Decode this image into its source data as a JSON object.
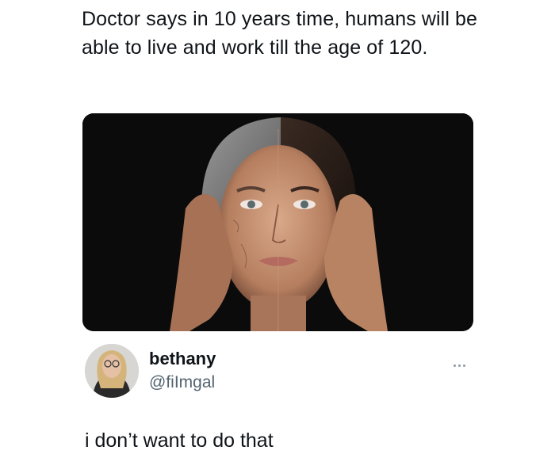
{
  "post": {
    "text": "Doctor says in 10 years time, humans will be able to live and work till the age of 120.",
    "image_description_icon": "aging-face-photo"
  },
  "reply": {
    "display_name": "bethany",
    "handle": "@fiImgal",
    "text": "i don’t want to do that",
    "more_icon": "ellipsis-icon",
    "avatar_icon": "profile-avatar"
  },
  "colors": {
    "text": "#0f1419",
    "secondary": "#536471",
    "background": "#ffffff"
  }
}
